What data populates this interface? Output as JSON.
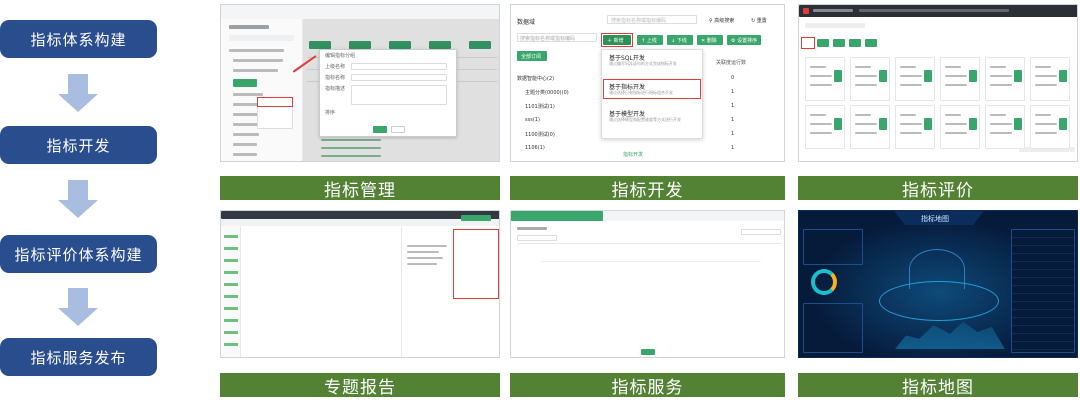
{
  "flow_steps": [
    "指标体系构建",
    "指标开发",
    "指标评价体系构建",
    "指标服务发布"
  ],
  "modules": {
    "manage": "指标管理",
    "develop": "指标开发",
    "evaluate": "指标评价",
    "report": "专题报告",
    "service": "指标服务",
    "map": "指标地图"
  },
  "develop_shot": {
    "tree_title": "数据域",
    "search_placeholder": "搜索指标名称或指标编码",
    "btn_new": "新增",
    "btn_up": "上线",
    "btn_down": "下线",
    "btn_delete": "删除",
    "btn_set": "设置排序",
    "btn_all": "全部订阅",
    "menu": [
      {
        "title": "基于SQL开发",
        "desc": "通过编写SQL语句的方式完成指标开发"
      },
      {
        "title": "基于指标开发",
        "desc": "通过选择已有指标进行指标组合开发"
      },
      {
        "title": "基于模型开发",
        "desc": "通过选择模型和配置维度等方式进行开发"
      }
    ],
    "tree_items": [
      "数据智能中心(2)",
      "主题分类(0000)(0)",
      "1101测试(1)",
      "sss(1)",
      "1100测试(0)",
      "1106(1)"
    ],
    "col_header": "关联度运行数",
    "col_values": [
      "0",
      "1",
      "1",
      "1",
      "1",
      "1"
    ],
    "dev_link": "指标开发",
    "reset_label": "重置"
  },
  "map_shot": {
    "title": "指标地图"
  },
  "manage_shot": {
    "dialog_title": "编辑指标分组",
    "fields": [
      "上级名称",
      "指标名称",
      "指标描述",
      "排序"
    ],
    "ok": "确定",
    "cancel": "取消"
  }
}
